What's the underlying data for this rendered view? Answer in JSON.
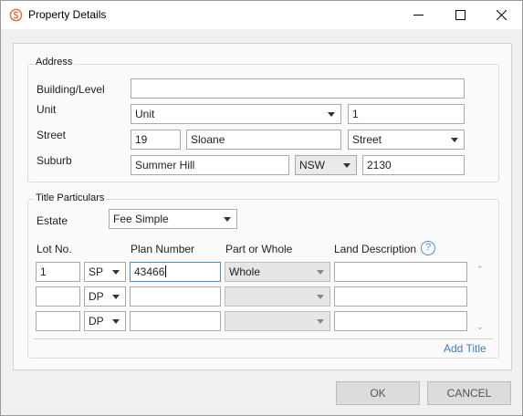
{
  "window": {
    "title": "Property Details"
  },
  "address": {
    "group_label": "Address",
    "building_label": "Building/Level",
    "building_value": "",
    "unit_label": "Unit",
    "unit_type": "Unit",
    "unit_number": "1",
    "street_label": "Street",
    "street_number": "19",
    "street_name": "Sloane",
    "street_type": "Street",
    "suburb_label": "Suburb",
    "suburb": "Summer Hill",
    "state": "NSW",
    "postcode": "2130"
  },
  "title": {
    "group_label": "Title Particulars",
    "estate_label": "Estate",
    "estate_value": "Fee Simple",
    "col_lot": "Lot No.",
    "col_plan": "Plan Number",
    "col_part": "Part or Whole",
    "col_land": "Land Description",
    "help_glyph": "?",
    "rows": [
      {
        "lot": "1",
        "plan_type": "SP",
        "plan_number": "43466",
        "part": "Whole",
        "land": ""
      },
      {
        "lot": "",
        "plan_type": "DP",
        "plan_number": "",
        "part": "",
        "land": ""
      },
      {
        "lot": "",
        "plan_type": "DP",
        "plan_number": "",
        "part": "",
        "land": ""
      }
    ],
    "add_title": "Add Title"
  },
  "buttons": {
    "ok": "OK",
    "cancel": "CANCEL"
  },
  "colors": {
    "accent": "#3b7fc4",
    "app_icon": "#e8703a"
  }
}
